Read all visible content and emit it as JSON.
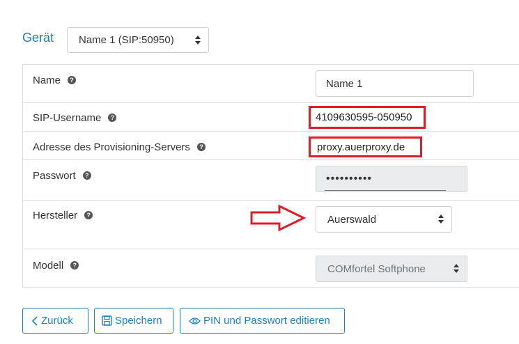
{
  "header": {
    "device_label": "Gerät",
    "device_select_value": "Name 1 (SIP:50950)"
  },
  "form": {
    "name": {
      "label": "Name",
      "value": "Name 1"
    },
    "sip_username": {
      "label": "SIP-Username",
      "value": "4109630595-050950"
    },
    "provisioning": {
      "label": "Adresse des Provisioning-Servers",
      "value": "proxy.auerproxy.de"
    },
    "password": {
      "label": "Passwort",
      "value": "••••••••••"
    },
    "manufacturer": {
      "label": "Hersteller",
      "value": "Auerswald"
    },
    "model": {
      "label": "Modell",
      "value": "COMfortel Softphone"
    },
    "help_glyph": "?"
  },
  "buttons": {
    "back": "Zurück",
    "save": "Speichern",
    "pin_password": "PIN und Passwort editieren"
  },
  "colors": {
    "accent": "#1a7fc1",
    "highlight": "#e01b24",
    "readonly_bg": "#e9ecef"
  },
  "icons": [
    "chevron-left-icon",
    "save-icon",
    "eye-icon",
    "help-icon",
    "arrow-right-icon",
    "select-caret-icon"
  ]
}
